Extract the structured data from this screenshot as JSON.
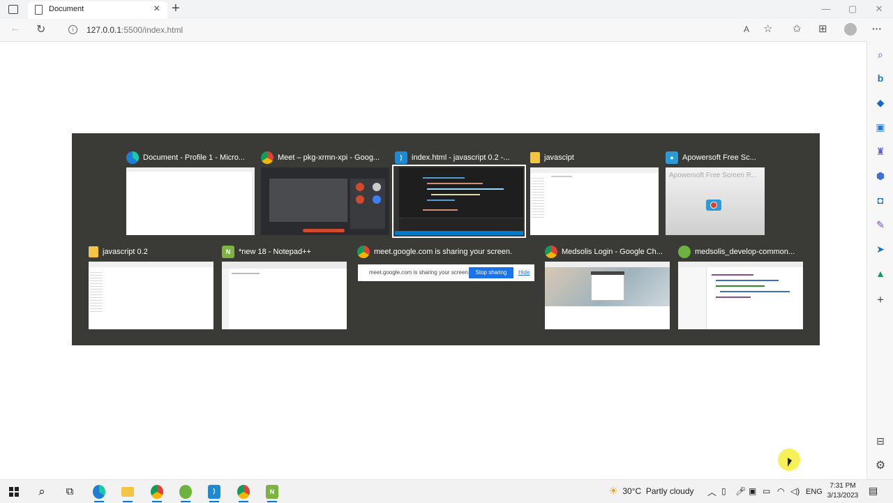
{
  "browser": {
    "tab_title": "Document",
    "new_tab": "+",
    "close": "×",
    "url_host": "127.0.0.1",
    "url_path": ":5500/index.html",
    "read_aloud": "A",
    "more": "···",
    "minimize": "—",
    "restore": "▢",
    "window_close": "✕"
  },
  "switcher": {
    "row1": [
      {
        "title": "Document - Profile 1 - Micro...",
        "icon": "edge-icon",
        "color": "#1b7fd6"
      },
      {
        "title": "Meet – pkg-xrmn-xpi - Goog...",
        "icon": "chrome-icon",
        "color": "#db4437"
      },
      {
        "title": "index.html - javascript 0.2 -...",
        "icon": "vscode-icon",
        "color": "#1f8ad2"
      },
      {
        "title": "javascipt",
        "icon": "folder-icon",
        "color": "#f4c542"
      },
      {
        "title": "Apowersoft Free Sc...",
        "icon": "apowersoft-icon",
        "color": "#2b9bd6"
      }
    ],
    "row2": [
      {
        "title": "javascript 0.2",
        "icon": "folder-icon",
        "color": "#f4c542"
      },
      {
        "title": "*new 18 - Notepad++",
        "icon": "notepadpp-icon",
        "color": "#7cb342"
      },
      {
        "title": "meet.google.com is sharing your screen.",
        "icon": "chrome-icon",
        "color": "#db4437"
      },
      {
        "title": "Medsolis Login - Google Ch...",
        "icon": "chrome-icon",
        "color": "#db4437"
      },
      {
        "title": "medsolis_develop-common...",
        "icon": "spring-icon",
        "color": "#6db33f"
      }
    ],
    "apowersoft_thumb_text": "Apowersoft Free Screen R...",
    "sharing_text": "meet.google.com is sharing your screen.",
    "stop_sharing": "Stop sharing",
    "hide": "Hide"
  },
  "taskbar": {
    "weather": "30°C  Partly cloudy",
    "lang": "ENG",
    "time": "7:31 PM",
    "date": "3/13/2023"
  }
}
